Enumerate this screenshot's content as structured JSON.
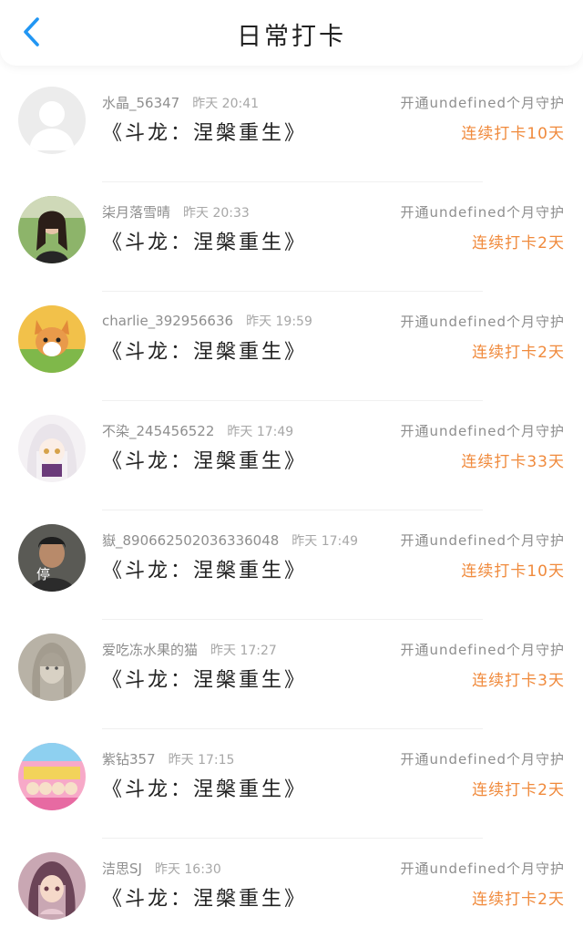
{
  "header": {
    "title": "日常打卡"
  },
  "rows": [
    {
      "name": "水晶_56347",
      "time": "昨天 20:41",
      "book": "《斗龙：涅槃重生》",
      "guard": "开通undefined个月守护",
      "streak": "连续打卡10天",
      "avatar": "default-avatar"
    },
    {
      "name": "柒月落雪晴",
      "time": "昨天 20:33",
      "book": "《斗龙：涅槃重生》",
      "guard": "开通undefined个月守护",
      "streak": "连续打卡2天",
      "avatar": "photo-girl-avatar"
    },
    {
      "name": "charlie_392956636",
      "time": "昨天 19:59",
      "book": "《斗龙：涅槃重生》",
      "guard": "开通undefined个月守护",
      "streak": "连续打卡2天",
      "avatar": "corgi-avatar"
    },
    {
      "name": "不染_245456522",
      "time": "昨天 17:49",
      "book": "《斗龙：涅槃重生》",
      "guard": "开通undefined个月守护",
      "streak": "连续打卡33天",
      "avatar": "anime-white-hair-avatar"
    },
    {
      "name": "嶽_890662502036336048",
      "time": "昨天 17:49",
      "book": "《斗龙：涅槃重生》",
      "guard": "开通undefined个月守护",
      "streak": "连续打卡10天",
      "avatar": "photo-man-avatar",
      "avatar_text": "停"
    },
    {
      "name": "爱吃冻水果的猫",
      "time": "昨天 17:27",
      "book": "《斗龙：涅槃重生》",
      "guard": "开通undefined个月守护",
      "streak": "连续打卡3天",
      "avatar": "sketch-girl-avatar"
    },
    {
      "name": "紫钻357",
      "time": "昨天 17:15",
      "book": "《斗龙：涅槃重生》",
      "guard": "开通undefined个月守护",
      "streak": "连续打卡2天",
      "avatar": "colorful-group-avatar"
    },
    {
      "name": "洁思SJ",
      "time": "昨天 16:30",
      "book": "《斗龙：涅槃重生》",
      "guard": "开通undefined个月守护",
      "streak": "连续打卡2天",
      "avatar": "anime-girl-avatar"
    }
  ],
  "colors": {
    "accent": "#2196f3",
    "streak": "#f08a3c",
    "muted": "#8e8e8e"
  }
}
